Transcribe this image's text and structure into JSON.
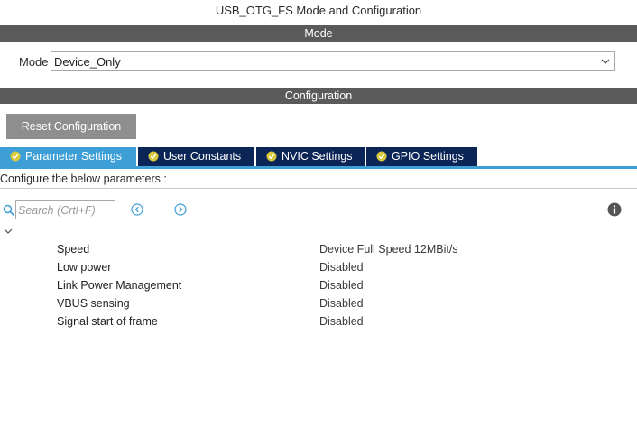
{
  "window": {
    "title": "USB_OTG_FS Mode and Configuration"
  },
  "mode_section": {
    "header": "Mode",
    "label": "Mode",
    "selected": "Device_Only"
  },
  "config_section": {
    "header": "Configuration",
    "reset_label": "Reset Configuration"
  },
  "tabs": [
    {
      "label": "Parameter Settings",
      "active": true
    },
    {
      "label": "User Constants",
      "active": false
    },
    {
      "label": "NVIC Settings",
      "active": false
    },
    {
      "label": "GPIO Settings",
      "active": false
    }
  ],
  "parameters_panel": {
    "instructions": "Configure the below parameters :",
    "search_placeholder": "Search (Crtl+F)",
    "rows": [
      {
        "name": "Speed",
        "value": "Device Full Speed 12MBit/s"
      },
      {
        "name": "Low power",
        "value": "Disabled"
      },
      {
        "name": "Link Power Management",
        "value": "Disabled"
      },
      {
        "name": "VBUS sensing",
        "value": "Disabled"
      },
      {
        "name": "Signal start of frame",
        "value": "Disabled"
      }
    ]
  },
  "colors": {
    "section_bar": "#5a5a5a",
    "tab_active": "#3d9fd6",
    "tab_inactive": "#0b2557",
    "check_badge": "#d9c93a",
    "reset_button": "#8e8e8e",
    "accent_icon": "#3d9fd6"
  },
  "icons": {
    "dropdown": "chevron-down-icon",
    "tab_status": "check-circle-icon",
    "search": "search-icon",
    "prev": "arrow-left-circle-icon",
    "next": "arrow-right-circle-icon",
    "info": "info-icon",
    "collapse": "chevron-down-icon"
  }
}
